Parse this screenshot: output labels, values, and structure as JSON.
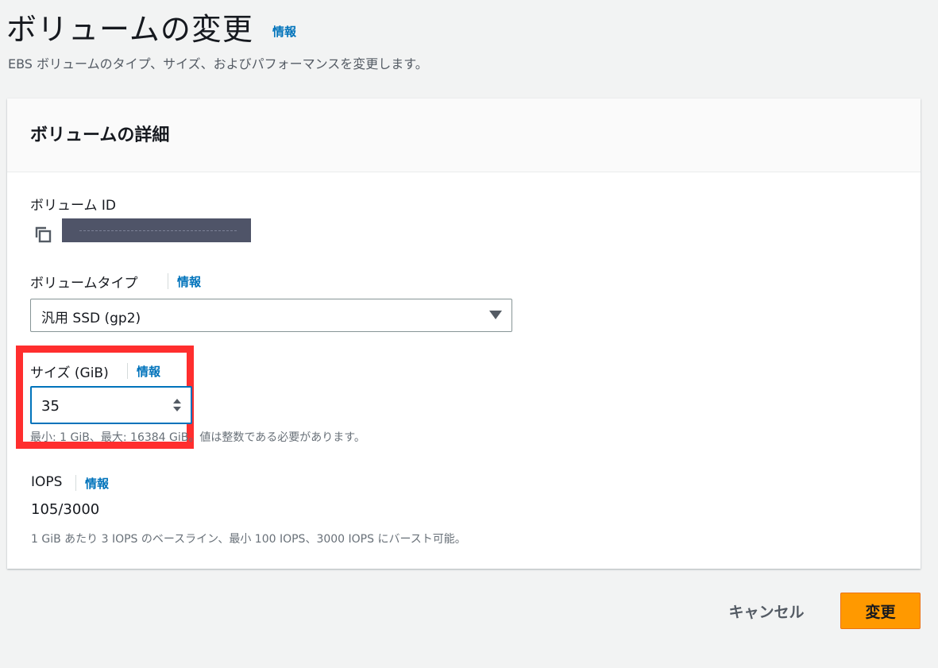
{
  "page": {
    "title": "ボリュームの変更",
    "title_info": "情報",
    "description": "EBS ボリュームのタイプ、サイズ、およびパフォーマンスを変更します。"
  },
  "panel": {
    "title": "ボリュームの詳細",
    "volume_id": {
      "label": "ボリューム ID",
      "copy_icon": "copy-icon"
    },
    "volume_type": {
      "label": "ボリュームタイプ",
      "info": "情報",
      "selected": "汎用 SSD (gp2)"
    },
    "size": {
      "label": "サイズ (GiB)",
      "info": "情報",
      "value": "35",
      "hint": "最小: 1 GiB、最大: 16384 GiB。値は整数である必要があります。"
    },
    "iops": {
      "label": "IOPS",
      "info": "情報",
      "value": "105/3000",
      "hint": "1 GiB あたり 3 IOPS のベースライン、最小 100 IOPS、3000 IOPS にバースト可能。"
    }
  },
  "actions": {
    "cancel": "キャンセル",
    "submit": "変更"
  },
  "colors": {
    "link": "#0073bb",
    "primary_button": "#ff9900",
    "highlight": "#ff2e2e",
    "background": "#f2f3f3"
  }
}
